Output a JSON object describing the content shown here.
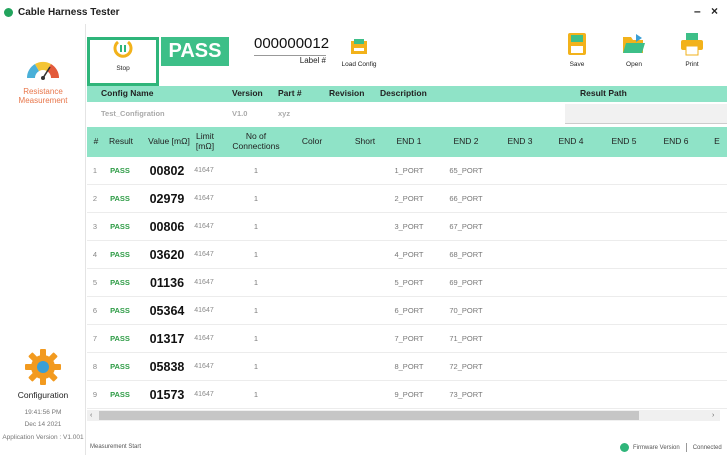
{
  "app": {
    "title": "Cable Harness Tester",
    "minimize": "–",
    "close": "×"
  },
  "sidebar": {
    "resistance_label_1": "Resistance",
    "resistance_label_2": "Measurement",
    "configuration_label": "Configuration",
    "time": "19:41:56 PM",
    "date": "Dec 14 2021",
    "app_version": "Application Version : V1.001"
  },
  "toolbar": {
    "stop_label": "Stop",
    "status": "PASS",
    "serial_number": "000000012",
    "label_hash": "Label #",
    "load_config": "Load Config",
    "save": "Save",
    "open": "Open",
    "print": "Print"
  },
  "config": {
    "headers": [
      "Config Name",
      "Version",
      "Part #",
      "Revision",
      "Description",
      "Result Path"
    ],
    "name": "Test_Configration",
    "version": "V1.0",
    "part": "xyz"
  },
  "table": {
    "headers": {
      "idx": "#",
      "result": "Result",
      "value": "Value [mΩ]",
      "limit_1": "Limit",
      "limit_2": "[mΩ]",
      "conn_1": "No of",
      "conn_2": "Connections",
      "color": "Color",
      "short": "Short",
      "end1": "END 1",
      "end2": "END 2",
      "end3": "END 3",
      "end4": "END 4",
      "end5": "END 5",
      "end6": "END 6",
      "end7": "E"
    },
    "rows": [
      {
        "idx": "1",
        "result": "PASS",
        "value": "00802",
        "limit": "41647",
        "connections": "1",
        "end1": "1_PORT",
        "end2": "65_PORT"
      },
      {
        "idx": "2",
        "result": "PASS",
        "value": "02979",
        "limit": "41647",
        "connections": "1",
        "end1": "2_PORT",
        "end2": "66_PORT"
      },
      {
        "idx": "3",
        "result": "PASS",
        "value": "00806",
        "limit": "41647",
        "connections": "1",
        "end1": "3_PORT",
        "end2": "67_PORT"
      },
      {
        "idx": "4",
        "result": "PASS",
        "value": "03620",
        "limit": "41647",
        "connections": "1",
        "end1": "4_PORT",
        "end2": "68_PORT"
      },
      {
        "idx": "5",
        "result": "PASS",
        "value": "01136",
        "limit": "41647",
        "connections": "1",
        "end1": "5_PORT",
        "end2": "69_PORT"
      },
      {
        "idx": "6",
        "result": "PASS",
        "value": "05364",
        "limit": "41647",
        "connections": "1",
        "end1": "6_PORT",
        "end2": "70_PORT"
      },
      {
        "idx": "7",
        "result": "PASS",
        "value": "01317",
        "limit": "41647",
        "connections": "1",
        "end1": "7_PORT",
        "end2": "71_PORT"
      },
      {
        "idx": "8",
        "result": "PASS",
        "value": "05838",
        "limit": "41647",
        "connections": "1",
        "end1": "8_PORT",
        "end2": "72_PORT"
      },
      {
        "idx": "9",
        "result": "PASS",
        "value": "01573",
        "limit": "41647",
        "connections": "1",
        "end1": "9_PORT",
        "end2": "73_PORT"
      }
    ]
  },
  "scroll": {
    "left_arrow": "‹",
    "right_arrow": "›"
  },
  "status": {
    "left": "Measurement Start",
    "firmware": "Firmware Version",
    "connection": "Connected"
  },
  "colors": {
    "accent": "#2fb57a",
    "header_bg": "#8fe3c7",
    "pass_text": "#2e9c46"
  },
  "icons": [
    "gauge-icon",
    "gear-icon",
    "stop-icon",
    "load-config-icon",
    "save-icon",
    "open-folder-icon",
    "print-icon",
    "status-dot-icon"
  ]
}
